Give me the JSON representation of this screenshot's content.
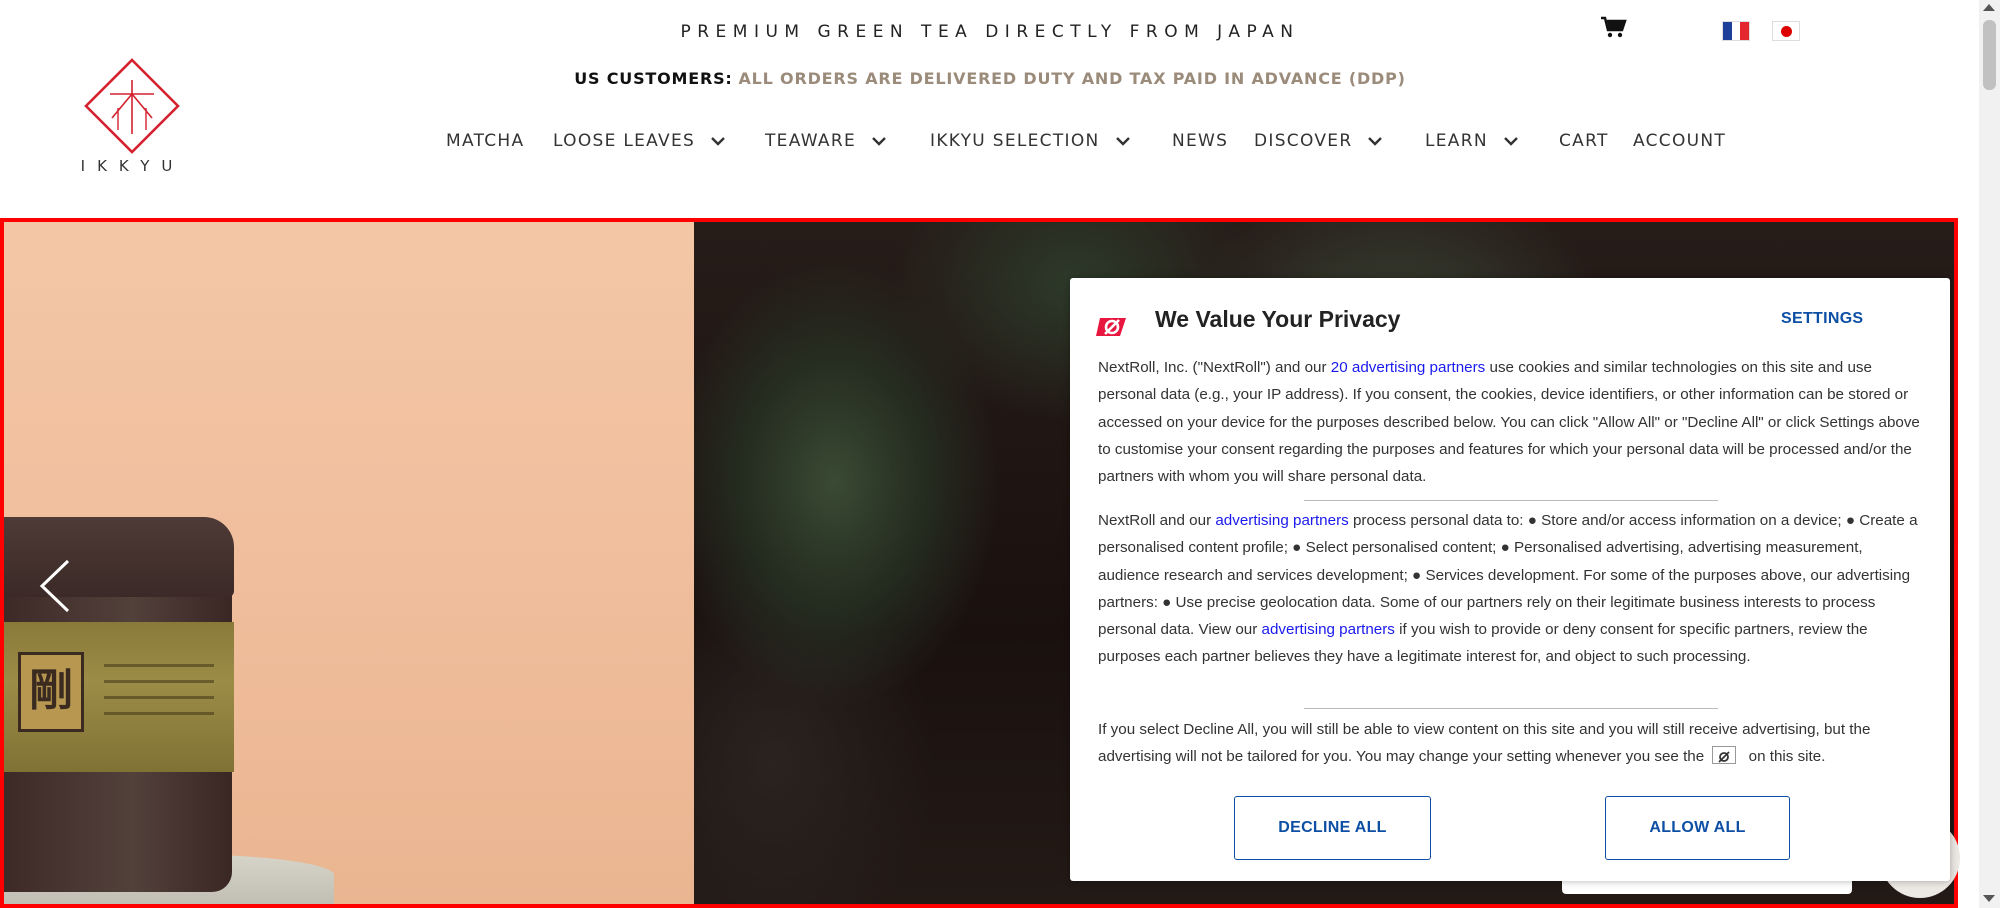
{
  "header": {
    "tagline": "PREMIUM GREEN TEA DIRECTLY FROM JAPAN",
    "us_label": "US CUSTOMERS:",
    "us_note": "ALL ORDERS ARE DELIVERED DUTY AND TAX PAID IN ADVANCE (DDP)",
    "logo_text": "IKKYU",
    "icons": {
      "cart": "cart-icon",
      "flag_fr": "france-flag-icon",
      "flag_jp": "japan-flag-icon"
    }
  },
  "nav": {
    "items": [
      {
        "label": "MATCHA",
        "has_dropdown": false
      },
      {
        "label": "LOOSE LEAVES",
        "has_dropdown": true
      },
      {
        "label": "TEAWARE",
        "has_dropdown": true
      },
      {
        "label": "IKKYU SELECTION",
        "has_dropdown": true
      },
      {
        "label": "NEWS",
        "has_dropdown": false
      },
      {
        "label": "DISCOVER",
        "has_dropdown": true
      },
      {
        "label": "LEARN",
        "has_dropdown": true
      },
      {
        "label": "CART",
        "has_dropdown": false
      },
      {
        "label": "ACCOUNT",
        "has_dropdown": false
      }
    ]
  },
  "hero": {
    "tin_kanji": "剛",
    "prev_icon": "chevron-left-icon"
  },
  "consent": {
    "title": "We Value Your Privacy",
    "settings_label": "SETTINGS",
    "p1_a": "NextRoll, Inc. (\"NextRoll\") and our ",
    "p1_link": "20 advertising partners",
    "p1_b": " use cookies and similar technologies on this site and use personal data (e.g., your IP address). If you consent, the cookies, device identifiers, or other information can be stored or accessed on your device for the purposes described below. You can click \"Allow All\" or \"Decline All\" or click Settings above to customise your consent regarding the purposes and features for which your personal data will be processed and/or the partners with whom you will share personal data.",
    "p2_a": "NextRoll and our ",
    "p2_link1": "advertising partners",
    "p2_b": " process personal data to: ● Store and/or access information on a device; ● Create a personalised content profile; ● Select personalised content; ● Personalised advertising, advertising measurement, audience research and services development; ● Services development. For some of the purposes above, our advertising partners: ● Use precise geolocation data. Some of our partners rely on their legitimate business interests to process personal data. View our ",
    "p2_link2": "advertising partners",
    "p2_c": " if you wish to provide or deny consent for specific partners, review the purposes each partner believes they have a legitimate interest for, and object to such processing.",
    "p3_a": "If you select Decline All, you will still be able to view content on this site and you will still receive advertising, but the advertising will not be tailored for you. You may change your setting whenever you see the ",
    "p3_b": " on this site.",
    "decline_label": "DECLINE ALL",
    "allow_label": "ALLOW ALL",
    "brand_color": "#e8173f",
    "link_color": "#1a1aee",
    "button_color": "#0d4fa4"
  }
}
